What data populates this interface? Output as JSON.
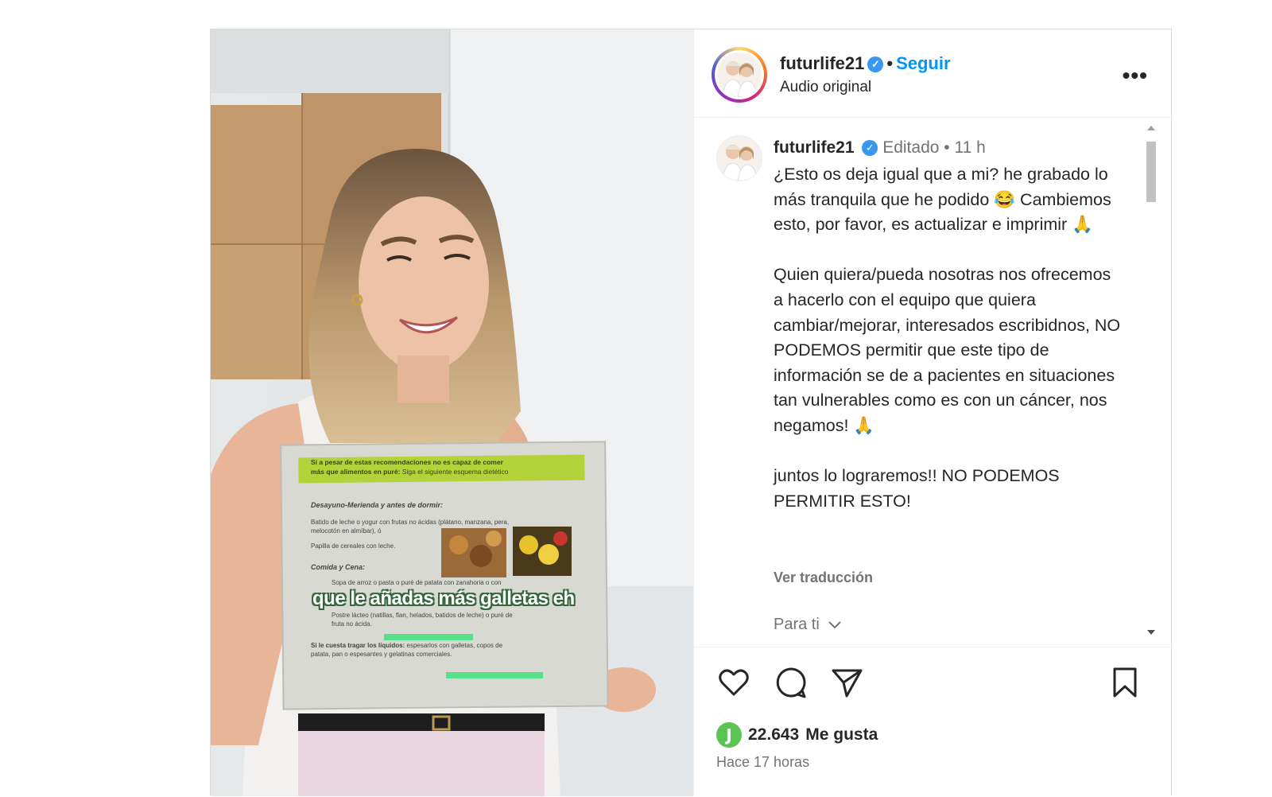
{
  "header": {
    "username": "futurlife21",
    "follow_label": "Seguir",
    "subtitle": "Audio original",
    "more_label": "•••"
  },
  "video": {
    "overlay_caption": "que le añadas más galletas eh",
    "sheet": {
      "banner_line1": "Si a pesar de estas recomendaciones no es capaz de comer",
      "banner_line2": "más que alimentos en puré:",
      "banner_line2_rest": "Siga el siguiente esquema dietético",
      "section1_title": "Desayuno-Merienda y antes de dormir:",
      "section1_line1": "Batido de leche o yogur con frutas no ácidas (plátano, manzana, pera,",
      "section1_line2": "melocotón en almíbar), ó",
      "section1_line3": "Papilla de cereales con leche.",
      "section2_title": "Comida y Cena:",
      "section2_item1": "Sopa de arroz o pasta o puré de patata con zanahoria o con",
      "section2_item3a": "Postre lácteo (natillas, flan, helados, batidos de leche) o puré de",
      "section2_item3b": "fruta no ácida.",
      "section3_title": "Si le cuesta tragar los líquidos:",
      "section3_line1": "espesarlos con galletas, copos de",
      "section3_line2": "patata, pan o espesantes y gelatinas comerciales."
    }
  },
  "comment": {
    "username": "futurlife21",
    "edited_label": "Editado",
    "separator": "•",
    "time": "11 h",
    "paragraphs": [
      "¿Esto os deja igual que a mi? he grabado lo más tranquila que he podido 😂 Cambiemos esto, por favor, es actualizar e imprimir 🙏",
      "Quien quiera/pueda nosotras nos ofrecemos a hacerlo con el equipo que quiera cambiar/mejorar, interesados escribidnos, NO PODEMOS permitir que este tipo de información se de a pacientes en situaciones tan vulnerables como es con un cáncer, nos negamos! 🙏",
      "juntos lo lograremos!! NO PODEMOS PERMITIR ESTO!"
    ],
    "translate_label": "Ver traducción",
    "for_you_label": "Para ti"
  },
  "actions": {
    "likes_count": "22.643",
    "likes_label": "Me gusta",
    "likes_badge": "J",
    "time_ago": "Hace 17 horas"
  },
  "colors": {
    "link_blue": "#0095f6",
    "verified_blue": "#3897f0",
    "muted_text": "#737373",
    "border": "#dbdbdb"
  }
}
